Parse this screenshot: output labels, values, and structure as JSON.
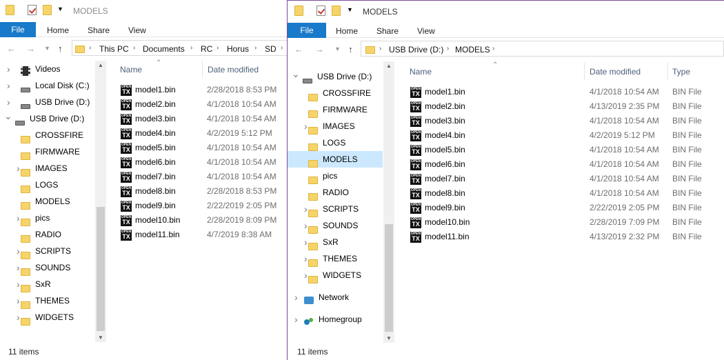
{
  "left": {
    "title": "MODELS",
    "ribbon": {
      "file": "File",
      "tabs": [
        "Home",
        "Share",
        "View"
      ]
    },
    "breadcrumbs": [
      "This PC",
      "Documents",
      "RC",
      "Horus",
      "SD"
    ],
    "nav": [
      {
        "label": "Videos",
        "icon": "videos-icon",
        "expand": true
      },
      {
        "label": "Local Disk (C:)",
        "icon": "local-disk-icon",
        "expand": true
      },
      {
        "label": "USB Drive (D:)",
        "icon": "usb-drive-icon",
        "expand": true
      },
      {
        "label": "USB Drive (D:)",
        "icon": "usb-drive-icon",
        "expand": "open"
      },
      {
        "label": "CROSSFIRE",
        "icon": "folder-icon",
        "expand": false
      },
      {
        "label": "FIRMWARE",
        "icon": "folder-icon",
        "expand": false
      },
      {
        "label": "IMAGES",
        "icon": "folder-icon",
        "expand": true
      },
      {
        "label": "LOGS",
        "icon": "folder-icon",
        "expand": false
      },
      {
        "label": "MODELS",
        "icon": "folder-icon",
        "expand": false
      },
      {
        "label": "pics",
        "icon": "folder-icon",
        "expand": true
      },
      {
        "label": "RADIO",
        "icon": "folder-icon",
        "expand": false
      },
      {
        "label": "SCRIPTS",
        "icon": "folder-icon",
        "expand": true
      },
      {
        "label": "SOUNDS",
        "icon": "folder-icon",
        "expand": true
      },
      {
        "label": "SxR",
        "icon": "folder-icon",
        "expand": true
      },
      {
        "label": "THEMES",
        "icon": "folder-icon",
        "expand": true
      },
      {
        "label": "WIDGETS",
        "icon": "folder-icon",
        "expand": true
      }
    ],
    "columns": [
      "Name",
      "Date modified"
    ],
    "files": [
      {
        "name": "model1.bin",
        "date": "2/28/2018 8:53 PM"
      },
      {
        "name": "model2.bin",
        "date": "4/1/2018 10:54 AM"
      },
      {
        "name": "model3.bin",
        "date": "4/1/2018 10:54 AM"
      },
      {
        "name": "model4.bin",
        "date": "4/2/2019 5:12 PM"
      },
      {
        "name": "model5.bin",
        "date": "4/1/2018 10:54 AM"
      },
      {
        "name": "model6.bin",
        "date": "4/1/2018 10:54 AM"
      },
      {
        "name": "model7.bin",
        "date": "4/1/2018 10:54 AM"
      },
      {
        "name": "model8.bin",
        "date": "2/28/2018 8:53 PM"
      },
      {
        "name": "model9.bin",
        "date": "2/22/2019 2:05 PM"
      },
      {
        "name": "model10.bin",
        "date": "2/28/2019 8:09 PM"
      },
      {
        "name": "model11.bin",
        "date": "4/7/2019 8:38 AM"
      }
    ],
    "status": "11 items"
  },
  "right": {
    "title": "MODELS",
    "ribbon": {
      "file": "File",
      "tabs": [
        "Home",
        "Share",
        "View"
      ]
    },
    "breadcrumbs": [
      "USB Drive (D:)",
      "MODELS"
    ],
    "nav": [
      {
        "label": "USB Drive (D:)",
        "icon": "usb-drive-icon",
        "expand": "open"
      },
      {
        "label": "CROSSFIRE",
        "icon": "folder-icon",
        "expand": false
      },
      {
        "label": "FIRMWARE",
        "icon": "folder-icon",
        "expand": false
      },
      {
        "label": "IMAGES",
        "icon": "folder-icon",
        "expand": true
      },
      {
        "label": "LOGS",
        "icon": "folder-icon",
        "expand": false
      },
      {
        "label": "MODELS",
        "icon": "folder-icon",
        "expand": false,
        "selected": true
      },
      {
        "label": "pics",
        "icon": "folder-icon",
        "expand": false
      },
      {
        "label": "RADIO",
        "icon": "folder-icon",
        "expand": false
      },
      {
        "label": "SCRIPTS",
        "icon": "folder-icon",
        "expand": true
      },
      {
        "label": "SOUNDS",
        "icon": "folder-icon",
        "expand": true
      },
      {
        "label": "SxR",
        "icon": "folder-icon",
        "expand": true
      },
      {
        "label": "THEMES",
        "icon": "folder-icon",
        "expand": true
      },
      {
        "label": "WIDGETS",
        "icon": "folder-icon",
        "expand": true
      }
    ],
    "nav_extra": [
      {
        "label": "Network",
        "icon": "network-icon"
      },
      {
        "label": "Homegroup",
        "icon": "homegroup-icon"
      }
    ],
    "columns": [
      "Name",
      "Date modified",
      "Type"
    ],
    "files": [
      {
        "name": "model1.bin",
        "date": "4/1/2018 10:54 AM",
        "type": "BIN File"
      },
      {
        "name": "model2.bin",
        "date": "4/13/2019 2:35 PM",
        "type": "BIN File"
      },
      {
        "name": "model3.bin",
        "date": "4/1/2018 10:54 AM",
        "type": "BIN File"
      },
      {
        "name": "model4.bin",
        "date": "4/2/2019 5:12 PM",
        "type": "BIN File"
      },
      {
        "name": "model5.bin",
        "date": "4/1/2018 10:54 AM",
        "type": "BIN File"
      },
      {
        "name": "model6.bin",
        "date": "4/1/2018 10:54 AM",
        "type": "BIN File"
      },
      {
        "name": "model7.bin",
        "date": "4/1/2018 10:54 AM",
        "type": "BIN File"
      },
      {
        "name": "model8.bin",
        "date": "4/1/2018 10:54 AM",
        "type": "BIN File"
      },
      {
        "name": "model9.bin",
        "date": "2/22/2019 2:05 PM",
        "type": "BIN File"
      },
      {
        "name": "model10.bin",
        "date": "2/28/2019 7:09 PM",
        "type": "BIN File"
      },
      {
        "name": "model11.bin",
        "date": "4/13/2019 2:32 PM",
        "type": "BIN File"
      }
    ],
    "status": "11 items"
  },
  "file_icon_text": {
    "top": "OPEN",
    "main": "TX"
  }
}
